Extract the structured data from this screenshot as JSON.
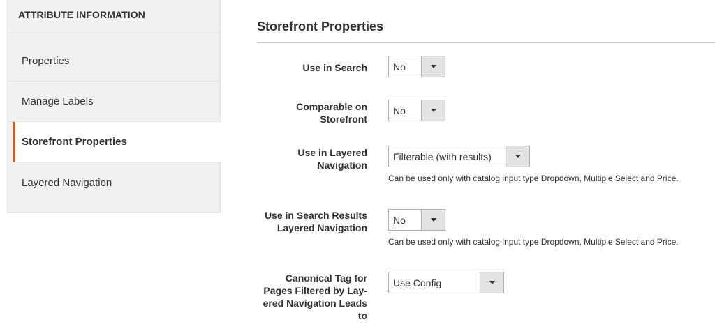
{
  "sidebar": {
    "title": "ATTRIBUTE INFORMATION",
    "items": [
      {
        "label": "Properties"
      },
      {
        "label": "Manage Labels"
      },
      {
        "label": "Storefront Properties"
      },
      {
        "label": "Layered Navigation"
      }
    ],
    "active_index": 2
  },
  "main": {
    "section_title": "Storefront Properties",
    "fields": {
      "use_in_search": {
        "label": "Use in Search",
        "value": "No"
      },
      "comparable": {
        "label_line1": "Comparable on",
        "label_line2": "Storefront",
        "value": "No"
      },
      "layered_nav": {
        "label_line1": "Use in Layered",
        "label_line2": "Navigation",
        "value": "Filterable (with results)",
        "note": "Can be used only with catalog input type Dropdown, Multiple Select and Price."
      },
      "search_results_layered_nav": {
        "label_line1": "Use in Search Results",
        "label_line2": "Layered Navigation",
        "value": "No",
        "note": "Can be used only with catalog input type Dropdown, Multiple Select and Price."
      },
      "canonical_tag": {
        "label_line1": "Canonical Tag for",
        "label_line2": "Pages Filtered by Lay-",
        "label_line3": "ered Navigation Leads",
        "label_line4": "to",
        "value": "Use Config"
      }
    }
  },
  "colors": {
    "accent": "#eb5202",
    "sidebar_bg": "#f1f1f1",
    "arrow_bg": "#e3e3e3"
  }
}
